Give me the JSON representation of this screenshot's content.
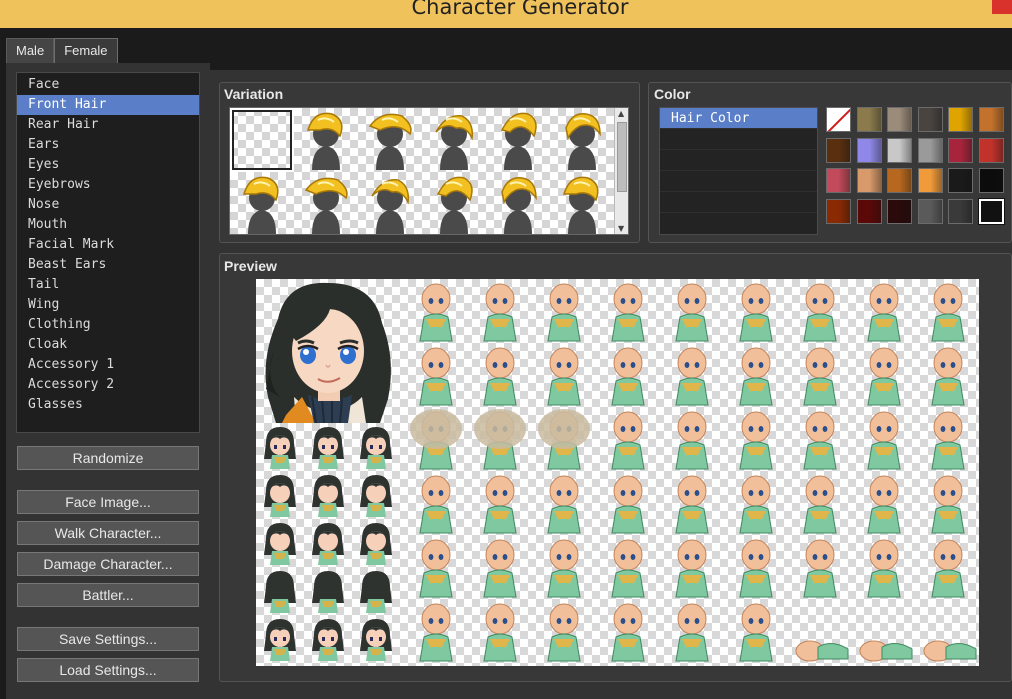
{
  "window": {
    "title": "Character Generator"
  },
  "tabs": [
    {
      "label": "Male",
      "active": false
    },
    {
      "label": "Female",
      "active": true
    }
  ],
  "parts": [
    "Face",
    "Front Hair",
    "Rear Hair",
    "Ears",
    "Eyes",
    "Eyebrows",
    "Nose",
    "Mouth",
    "Facial Mark",
    "Beast Ears",
    "Tail",
    "Wing",
    "Clothing",
    "Cloak",
    "Accessory 1",
    "Accessory 2",
    "Glasses"
  ],
  "selected_part": "Front Hair",
  "buttons": {
    "randomize": "Randomize",
    "face_image": "Face Image...",
    "walk_character": "Walk Character...",
    "damage_character": "Damage Character...",
    "battler": "Battler...",
    "save_settings": "Save Settings...",
    "load_settings": "Load Settings..."
  },
  "variation": {
    "label": "Variation",
    "item_count": 12,
    "selected_index": 0
  },
  "color": {
    "label": "Color",
    "options": [
      "Hair Color"
    ],
    "selected": "Hair Color",
    "swatches": [
      "none",
      "#8a7a4c",
      "#9b8b7a",
      "#4a4440",
      "#e0a400",
      "#c2722c",
      "#5a2f0f",
      "#8f88e8",
      "#c8c8c8",
      "#9a9a9a",
      "#a8243c",
      "#c0322a",
      "#c24a5a",
      "#d89a6a",
      "#b8681e",
      "#f09a3a",
      "#1a1a1a",
      "#0c0c0c",
      "#8a2a02",
      "#5a0808",
      "#2a0a0a",
      "#5a5a5a",
      "#3a3a3a",
      "#111111"
    ],
    "selected_swatch_index": 23
  },
  "preview": {
    "label": "Preview"
  }
}
